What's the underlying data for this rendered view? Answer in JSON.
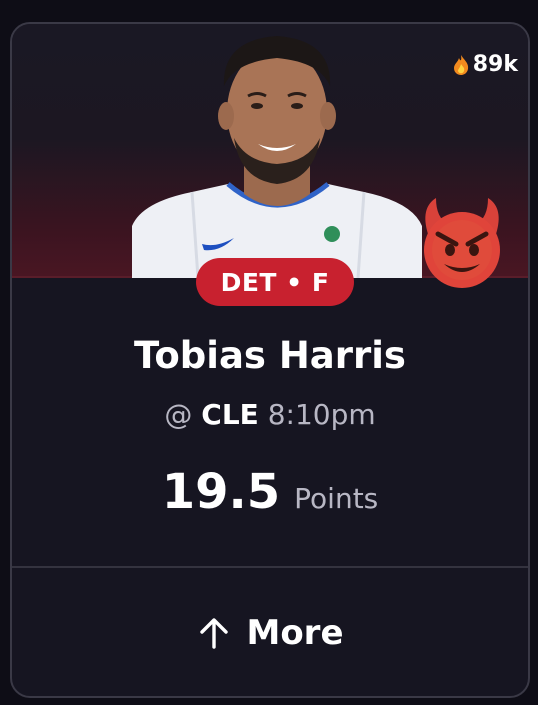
{
  "card": {
    "popularity": "89k",
    "position_badge": "DET • F",
    "player_name": "Tobias Harris",
    "matchup": {
      "prefix": "@",
      "opponent": "CLE",
      "time": "8:10pm"
    },
    "line": {
      "value": "19.5",
      "stat": "Points"
    },
    "more_label": "More",
    "icons": {
      "popularity": "fire-icon",
      "tag": "devil-emoji-icon",
      "more": "arrow-up-icon"
    },
    "colors": {
      "badge": "#c8212f",
      "background": "#161521"
    }
  }
}
